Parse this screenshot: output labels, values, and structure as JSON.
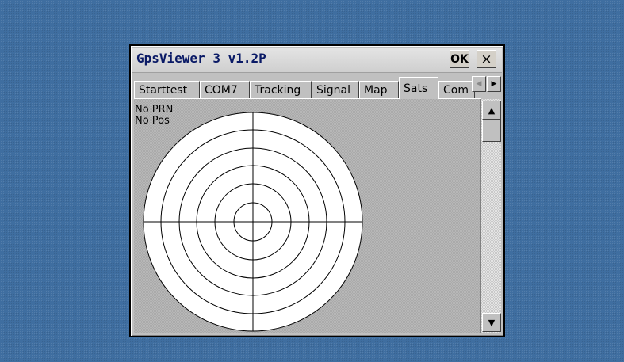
{
  "desktop": {
    "background_color": "#3f6ea0"
  },
  "window": {
    "title": "GpsViewer 3 v1.2P",
    "ok_label": "OK",
    "close_label": "×"
  },
  "tabs": [
    {
      "label": "Starttest",
      "active": false
    },
    {
      "label": "COM7",
      "active": false
    },
    {
      "label": "Tracking",
      "active": false
    },
    {
      "label": "Signal",
      "active": false
    },
    {
      "label": "Map",
      "active": false
    },
    {
      "label": "Sats",
      "active": true
    },
    {
      "label": "Com",
      "active": false
    }
  ],
  "tab_scroll": {
    "left_icon": "◀",
    "right_icon": "▶"
  },
  "sats_panel": {
    "prn_text": "No PRN",
    "pos_text": "No Pos",
    "skyplot": {
      "ring_count": 6,
      "crosshair": true,
      "ring_color": "#000000",
      "fill_color": "#ffffff"
    }
  },
  "scrollbar": {
    "up_icon": "▲",
    "down_icon": "▼"
  }
}
